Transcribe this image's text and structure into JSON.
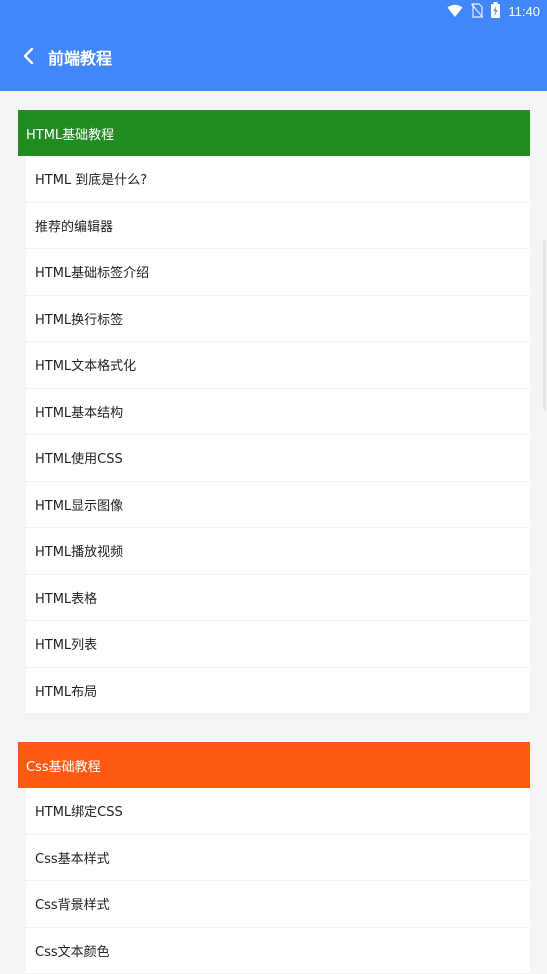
{
  "status_bar": {
    "time": "11:40",
    "icons": [
      "wifi-icon",
      "no-sim-icon",
      "battery-charging-icon"
    ]
  },
  "app_bar": {
    "title": "前端教程",
    "back_icon": "chevron-left-icon"
  },
  "colors": {
    "primary": "#4287fa",
    "section_html": "#228b22",
    "section_css": "#ff5a14"
  },
  "sections": [
    {
      "title": "HTML基础教程",
      "items": [
        "HTML 到底是什么?",
        "推荐的编辑器",
        "HTML基础标签介绍",
        "HTML换行标签",
        "HTML文本格式化",
        "HTML基本结构",
        "HTML使用CSS",
        "HTML显示图像",
        "HTML播放视频",
        "HTML表格",
        "HTML列表",
        "HTML布局"
      ]
    },
    {
      "title": "Css基础教程",
      "items": [
        "HTML绑定CSS",
        "Css基本样式",
        "Css背景样式",
        "Css文本颜色"
      ]
    }
  ]
}
